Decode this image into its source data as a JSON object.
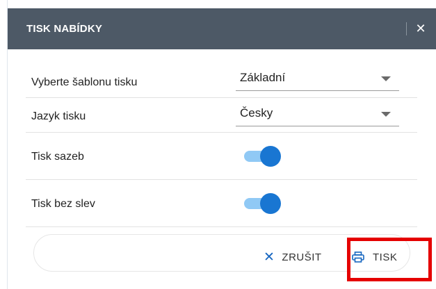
{
  "dialog": {
    "title": "TISK NABÍDKY",
    "close_icon": "close-icon"
  },
  "form": {
    "template": {
      "label": "Vyberte šablonu tisku",
      "value": "Základní"
    },
    "language": {
      "label": "Jazyk tisku",
      "value": "Česky"
    },
    "print_rates": {
      "label": "Tisk sazeb",
      "checked": true
    },
    "print_no_discounts": {
      "label": "Tisk bez slev",
      "checked": true
    }
  },
  "footer": {
    "cancel_label": "ZRUŠIT",
    "print_label": "TISK"
  },
  "colors": {
    "header_bg": "#4d5966",
    "accent": "#1976d2",
    "toggle_track": "#90c9f5",
    "highlight": "#e50000"
  }
}
